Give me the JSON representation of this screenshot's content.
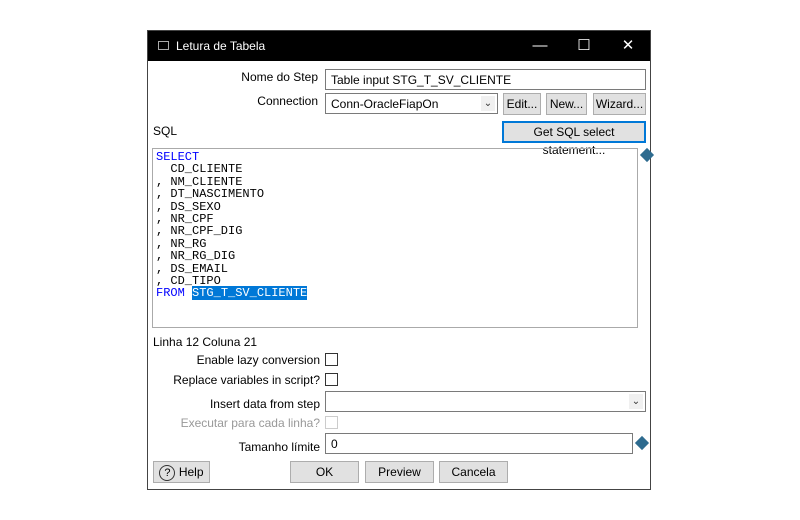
{
  "window": {
    "title": "Letura de Tabela",
    "minimize": "—",
    "maximize": "☐",
    "close": "✕"
  },
  "form": {
    "step_name_label": "Nome do Step",
    "step_name_value": "Table input STG_T_SV_CLIENTE",
    "connection_label": "Connection",
    "connection_value": "Conn-OracleFiapOn",
    "edit_button": "Edit...",
    "new_button": "New...",
    "wizard_button": "Wizard...",
    "sql_label": "SQL",
    "get_sql_button": "Get SQL select statement...",
    "sql_lines": [
      "SELECT",
      "  CD_CLIENTE",
      ", NM_CLIENTE",
      ", DT_NASCIMENTO",
      ", DS_SEXO",
      ", NR_CPF",
      ", NR_CPF_DIG",
      ", NR_RG",
      ", NR_RG_DIG",
      ", DS_EMAIL",
      ", CD_TIPO"
    ],
    "sql_from_keyword": "FROM",
    "sql_from_table": "STG_T_SV_CLIENTE",
    "cursor_position": "Linha 12 Coluna 21",
    "lazy_conversion_label": "Enable lazy conversion",
    "lazy_conversion_checked": false,
    "replace_variables_label": "Replace variables in script?",
    "replace_variables_checked": false,
    "insert_data_label": "Insert data from step",
    "insert_data_value": "",
    "execute_each_row_label": "Executar para cada linha?",
    "execute_each_row_checked": false,
    "limit_label": "Tamanho límite",
    "limit_value": "0"
  },
  "footer": {
    "help_button": "Help",
    "ok_button": "OK",
    "preview_button": "Preview",
    "cancel_button": "Cancela"
  }
}
